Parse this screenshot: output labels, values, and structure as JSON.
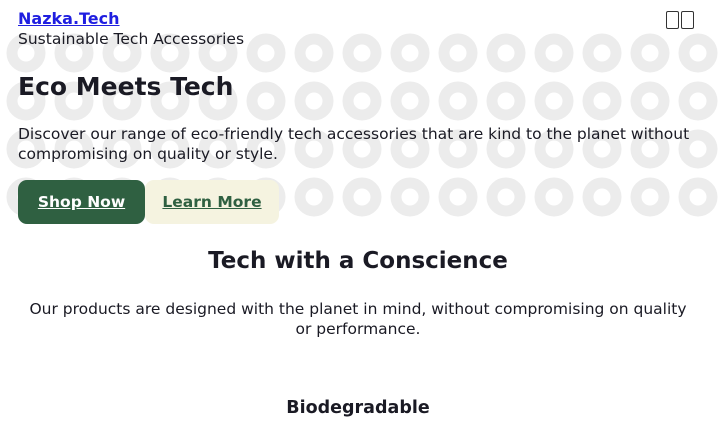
{
  "header": {
    "brand": "Nazka.Tech",
    "tagline": "Sustainable Tech Accessories"
  },
  "hero": {
    "title": "Eco Meets Tech",
    "description": "Discover our range of eco-friendly tech accessories that are kind to the planet without compromising on quality or style.",
    "primary_cta": "Shop Now",
    "secondary_cta": "Learn More"
  },
  "section": {
    "title": "Tech with a Conscience",
    "description": "Our products are designed with the planet in mind, without compromising on quality or performance."
  },
  "features": [
    {
      "title": "Biodegradable"
    }
  ],
  "icons": {
    "menu": "menu-toggle-icon",
    "pattern": "ring-pattern"
  },
  "colors": {
    "link": "#1f1ee0",
    "primary_button": "#2f6041",
    "secondary_button": "#f5f3e0",
    "pattern": "#ececec",
    "text": "#1a1a24"
  }
}
